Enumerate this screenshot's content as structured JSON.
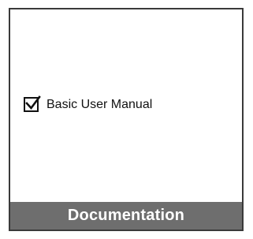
{
  "panel": {
    "options": [
      {
        "label": "Basic User Manual",
        "checked": true,
        "icon": "checkmark-icon"
      }
    ],
    "footer_title": "Documentation"
  },
  "colors": {
    "border": "#3a3a3a",
    "footer_bg": "#6e6e6e",
    "footer_text": "#ffffff",
    "text": "#111111"
  }
}
